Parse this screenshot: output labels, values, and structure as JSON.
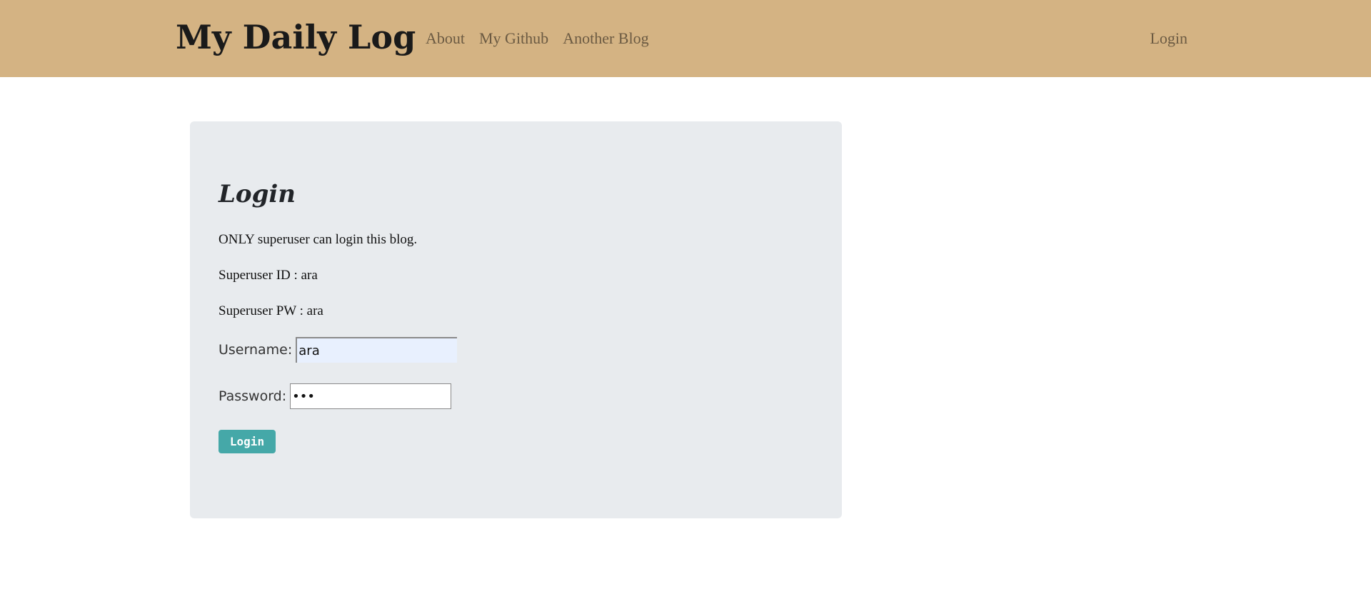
{
  "navbar": {
    "brand": "My Daily Log",
    "links": [
      "About",
      "My Github",
      "Another Blog"
    ],
    "login": "Login"
  },
  "login_card": {
    "title": "Login",
    "info_lines": [
      "ONLY superuser can login this blog.",
      "Superuser ID : ara",
      "Superuser PW : ara"
    ],
    "username": {
      "label": "Username:",
      "value": "ara"
    },
    "password": {
      "label": "Password:",
      "value": "ara"
    },
    "submit_label": "Login"
  },
  "colors": {
    "navbar_bg": "#d4b383",
    "card_bg": "#e8ebee",
    "button_bg": "#45a8a8",
    "autofill_bg": "#e8f0fe"
  }
}
